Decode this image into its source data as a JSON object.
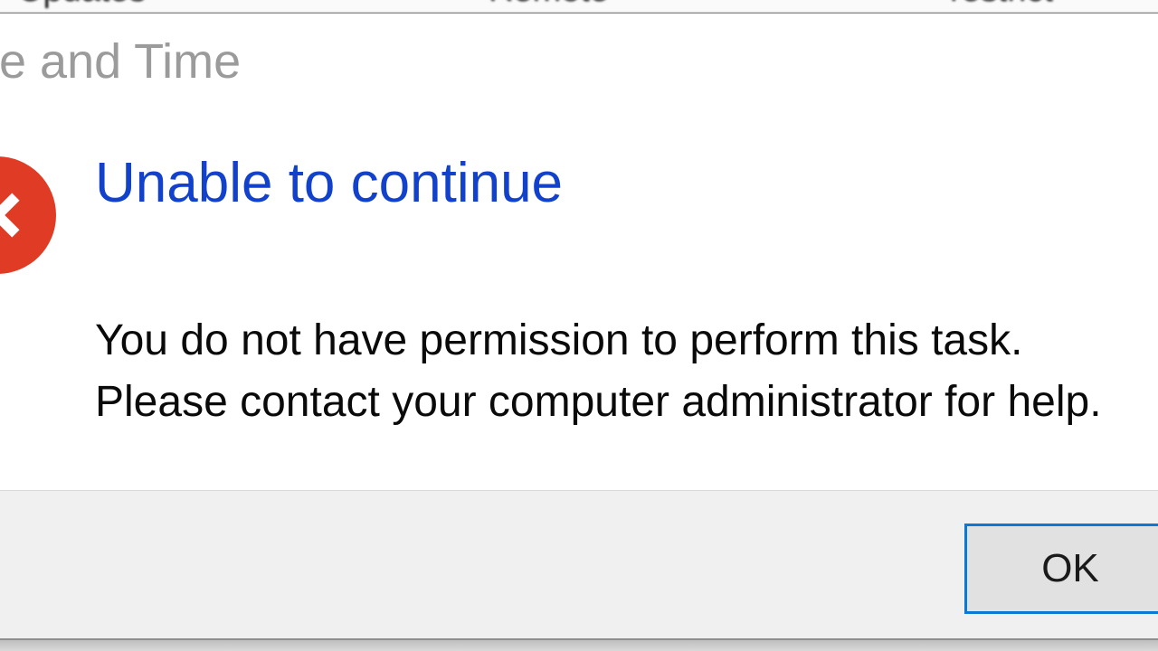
{
  "bg": {
    "tab1": "Updates",
    "tab2": "Remote",
    "tab3": "restrict"
  },
  "dialog": {
    "title": "e and Time",
    "icon": "error-cross-icon",
    "heading": "Unable to continue",
    "body_line1": "You do not have permission to perform this task.",
    "body_line2": "Please contact your computer administrator for help.",
    "ok_label": "OK"
  }
}
